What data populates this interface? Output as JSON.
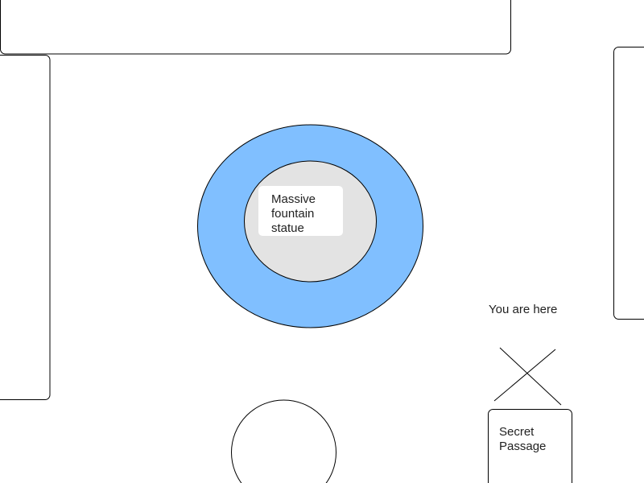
{
  "map": {
    "fountain": {
      "label_lines": [
        "Massive",
        "fountain",
        "statue"
      ],
      "water_color": "#80bfff",
      "basin_color": "#e3e3e3"
    },
    "marker": {
      "label": "You are here",
      "icon": "x-mark-icon"
    },
    "secret_passage": {
      "label_lines": [
        "Secret",
        "Passage"
      ]
    },
    "colors": {
      "background": "#ffffff",
      "outline": "#000000",
      "text": "#222222"
    }
  }
}
